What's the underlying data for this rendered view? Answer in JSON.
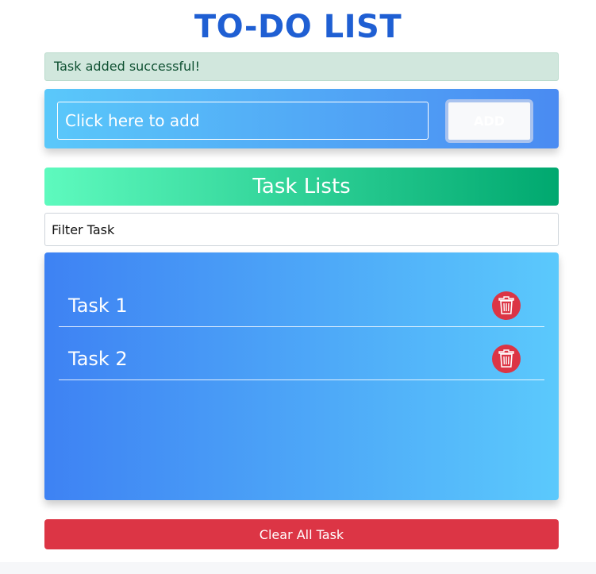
{
  "app": {
    "title": "TO-DO LIST"
  },
  "alert": {
    "message": "Task added successful!"
  },
  "add_form": {
    "placeholder": "Click here to add",
    "button_label": "ADD"
  },
  "task_list": {
    "header": "Task Lists",
    "filter_placeholder": "Filter Task",
    "items": [
      {
        "label": "Task 1",
        "delete_icon": "trash-icon"
      },
      {
        "label": "Task 2",
        "delete_icon": "trash-icon"
      }
    ]
  },
  "clear_button": {
    "label": "Clear All Task"
  },
  "colors": {
    "title": "#1f5fd3",
    "alert_bg": "#d1e7dd",
    "alert_text": "#0f5132",
    "add_gradient_start": "#5ac8fa",
    "add_gradient_end": "#4a8bf2",
    "header_gradient_start": "#5efabe",
    "header_gradient_end": "#00a86f",
    "panel_gradient_start": "#3e82f3",
    "panel_gradient_end": "#5bc9fc",
    "danger": "#dc3545"
  }
}
